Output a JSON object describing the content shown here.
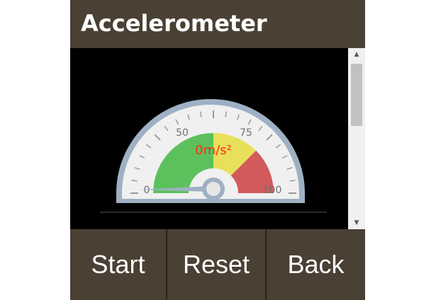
{
  "title": "Accelerometer",
  "gauge": {
    "value": 0,
    "min": 0,
    "max": 100,
    "value_label": "0m/s²",
    "tick_labels": [
      "0",
      "50",
      "75",
      "100"
    ],
    "bands": [
      {
        "from": 0,
        "to": 50,
        "color": "#5cc15c"
      },
      {
        "from": 50,
        "to": 75,
        "color": "#e8e05a"
      },
      {
        "from": 75,
        "to": 100,
        "color": "#d25a5a"
      }
    ],
    "value_color": "#ff2a1a"
  },
  "buttons": {
    "start": "Start",
    "reset": "Reset",
    "back": "Back"
  },
  "colors": {
    "bar": "#4a4034",
    "background": "#000000"
  }
}
